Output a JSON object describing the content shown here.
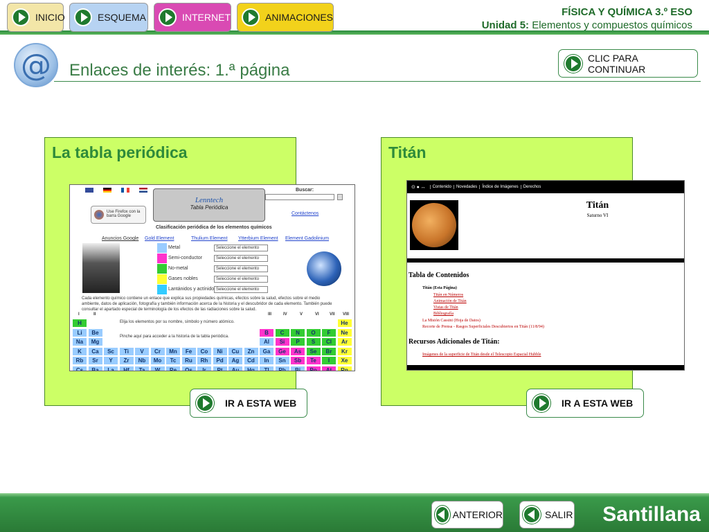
{
  "nav": {
    "inicio": "INICIO",
    "esquema": "ESQUEMA",
    "internet": "INTERNET",
    "animaciones": "ANIMACIONES"
  },
  "header": {
    "course": "FÍSICA Y QUÍMICA 3.º ESO",
    "unit_label": "Unidad 5:",
    "unit_title": "Elementos y compuestos químicos"
  },
  "page": {
    "title": "Enlaces de interés: 1.ª página",
    "continue_label": "CLIC PARA CONTINUAR"
  },
  "panels": [
    {
      "title": "La tabla periódica",
      "button": "IR A ESTA WEB",
      "preview": {
        "search_label": "Buscar:",
        "firefox": "Use Firefox con la barra Google",
        "brand": "Lenntech",
        "brand_sub": "Tabla Periódica",
        "contact": "Contáctenos",
        "heading": "Clasificación periódica de los elementos químicos",
        "links": [
          "Anuncios Google",
          "Gold Element",
          "Thulium Element",
          "Ytterbium Element",
          "Element Gadolinium"
        ],
        "legend": [
          {
            "label": "Metal",
            "color": "#99ccff"
          },
          {
            "label": "Semi-conductor",
            "color": "#ff33cc"
          },
          {
            "label": "No-metal",
            "color": "#33cc33"
          },
          {
            "label": "Gases nobles",
            "color": "#ffff33"
          },
          {
            "label": "Lantánidos y actínidos",
            "color": "#33ccff"
          }
        ],
        "select_text": "Seleccione el elemento",
        "desc": "Cada elemento químico contiene un enlace que explica sus propiedades químicas, efectos sobre la salud, efectos sobre el medio ambiente, datos de aplicación, fotografía y también información acerca de la historia y el descubridor de cada elemento. También puede consultar el apartado especial de terminología de los efectos de las radiaciones sobre la salud.",
        "choose": "Elija los elementos por su nombre, símbolo y número atómico.",
        "history": "Pinche aquí para acceder a la historia de la tabla periódica.",
        "groups": [
          "I",
          "II",
          "III",
          "IV",
          "V",
          "VI",
          "VII",
          "VIII"
        ]
      }
    },
    {
      "title": "Titán",
      "button": "IR A ESTA WEB",
      "preview": {
        "menu": [
          "Contenido",
          "Novedades",
          "Índice de Imágenes",
          "Derechos"
        ],
        "name": "Titán",
        "sub": "Saturno VI",
        "toc_title": "Tabla de Contenidos",
        "toc_main": "Titán (Esta Página)",
        "toc_sub": [
          "Titán en Números",
          "Animación de Titán",
          "Vistas de Titán",
          "Bibliografía"
        ],
        "toc_more": [
          "La Misión Cassini (Hoja de Datos)",
          "Recorte de Prensa - Rasgos Superficiales Descubiertos en Titán (11/8/94)"
        ],
        "res_title": "Recursos Adicionales de Titán:",
        "res_item": "Imágenes de la superficie de Titán desde el Telescopio Espacial Hubble"
      }
    }
  ],
  "footer": {
    "anterior": "ANTERIOR",
    "salir": "SALIR",
    "brand": "Santillana"
  }
}
